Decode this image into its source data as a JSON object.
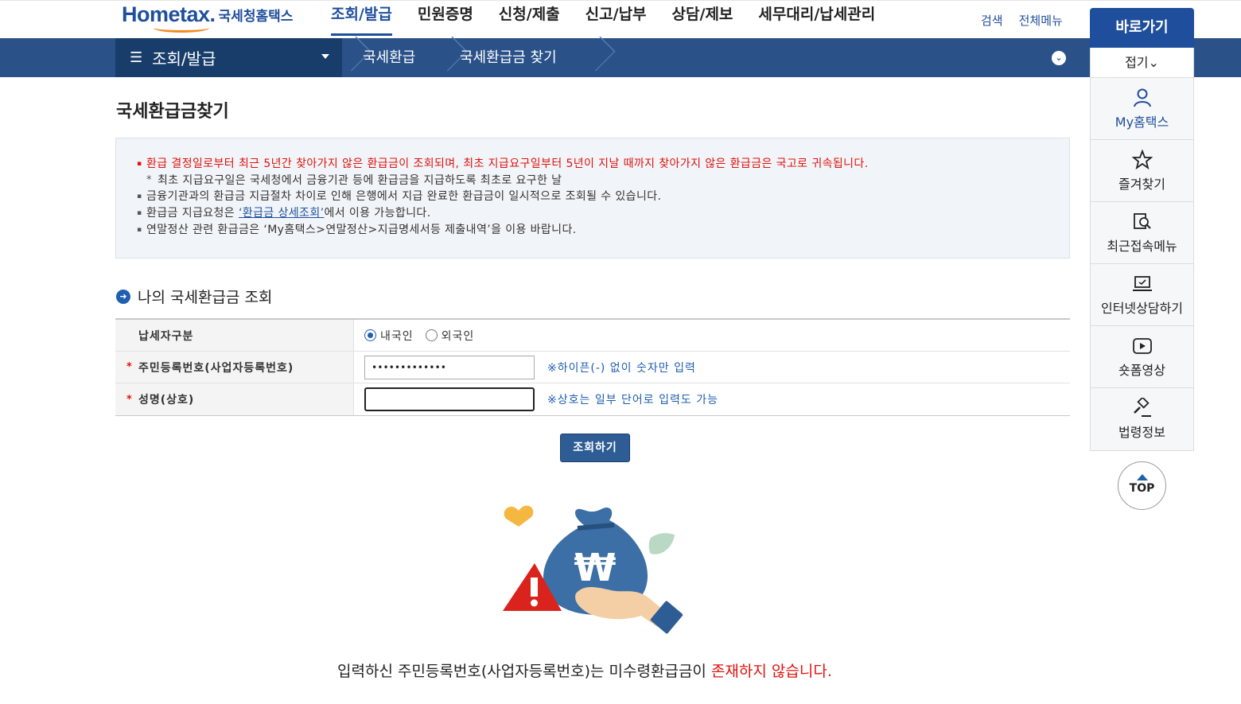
{
  "header": {
    "logo_main": "Hometax.",
    "logo_sub": "국세청홈택스",
    "nav": [
      "조회/발급",
      "민원증명",
      "신청/제출",
      "신고/납부",
      "상담/제보",
      "세무대리/납세관리"
    ],
    "util": [
      "검색",
      "전체메뉴"
    ]
  },
  "location": {
    "menu_label": "조회/발급",
    "crumbs": [
      "국세환급",
      "국세환급금 찾기"
    ]
  },
  "page": {
    "title": "국세환급금찾기",
    "notices": [
      "환급 결정일로부터 최근 5년간 찾아가지 않은 환급금이 조회되며, 최초 지급요구일부터 5년이 지날 때까지 찾아가지 않은 환급금은 국고로 귀속됩니다.",
      "최초 지급요구일은 국세청에서 금융기관 등에 환급금을 지급하도록 최초로 요구한 날",
      "금융기관과의 환급금 지급절차 차이로 인해 은행에서 지급 완료한 환급금이 일시적으로 조회될 수 있습니다.",
      "환급금 지급요청은 ",
      "‘환급금 상세조회’",
      "에서 이용 가능합니다.",
      "연말정산 관련 환급금은 ‘My홈택스>연말정산>지급명세서등 제출내역’을 이용 바랍니다."
    ],
    "section_title": "나의 국세환급금 조회",
    "form": {
      "taxpayer_type_label": "납세자구분",
      "option_domestic": "내국인",
      "option_foreign": "외국인",
      "id_label": "주민등록번호(사업자등록번호)",
      "id_value": "•••••••••••••",
      "id_hint": "※하이픈(-) 없이 숫자만 입력",
      "name_label": "성명(상호)",
      "name_value": "",
      "name_hint": "※상호는 일부 단어로 입력도 가능",
      "required_mark": "*"
    },
    "submit_label": "조회하기",
    "result_prefix": "입력하신 주민등록번호(사업자등록번호)는 미수령환급금이 ",
    "result_emphasis": "존재하지 않습니다."
  },
  "quick_menu": {
    "title": "바로가기",
    "fold_label": "접기⌄",
    "items": [
      "My홈택스",
      "즐겨찾기",
      "최근접속메뉴",
      "인터넷상담하기",
      "숏폼영상",
      "법령정보"
    ],
    "top_label": "TOP"
  },
  "colors": {
    "brand_blue": "#1f4f9c",
    "location_bar": "#2a5289",
    "alert_red": "#e0120c",
    "accent_orange": "#f08a24"
  }
}
